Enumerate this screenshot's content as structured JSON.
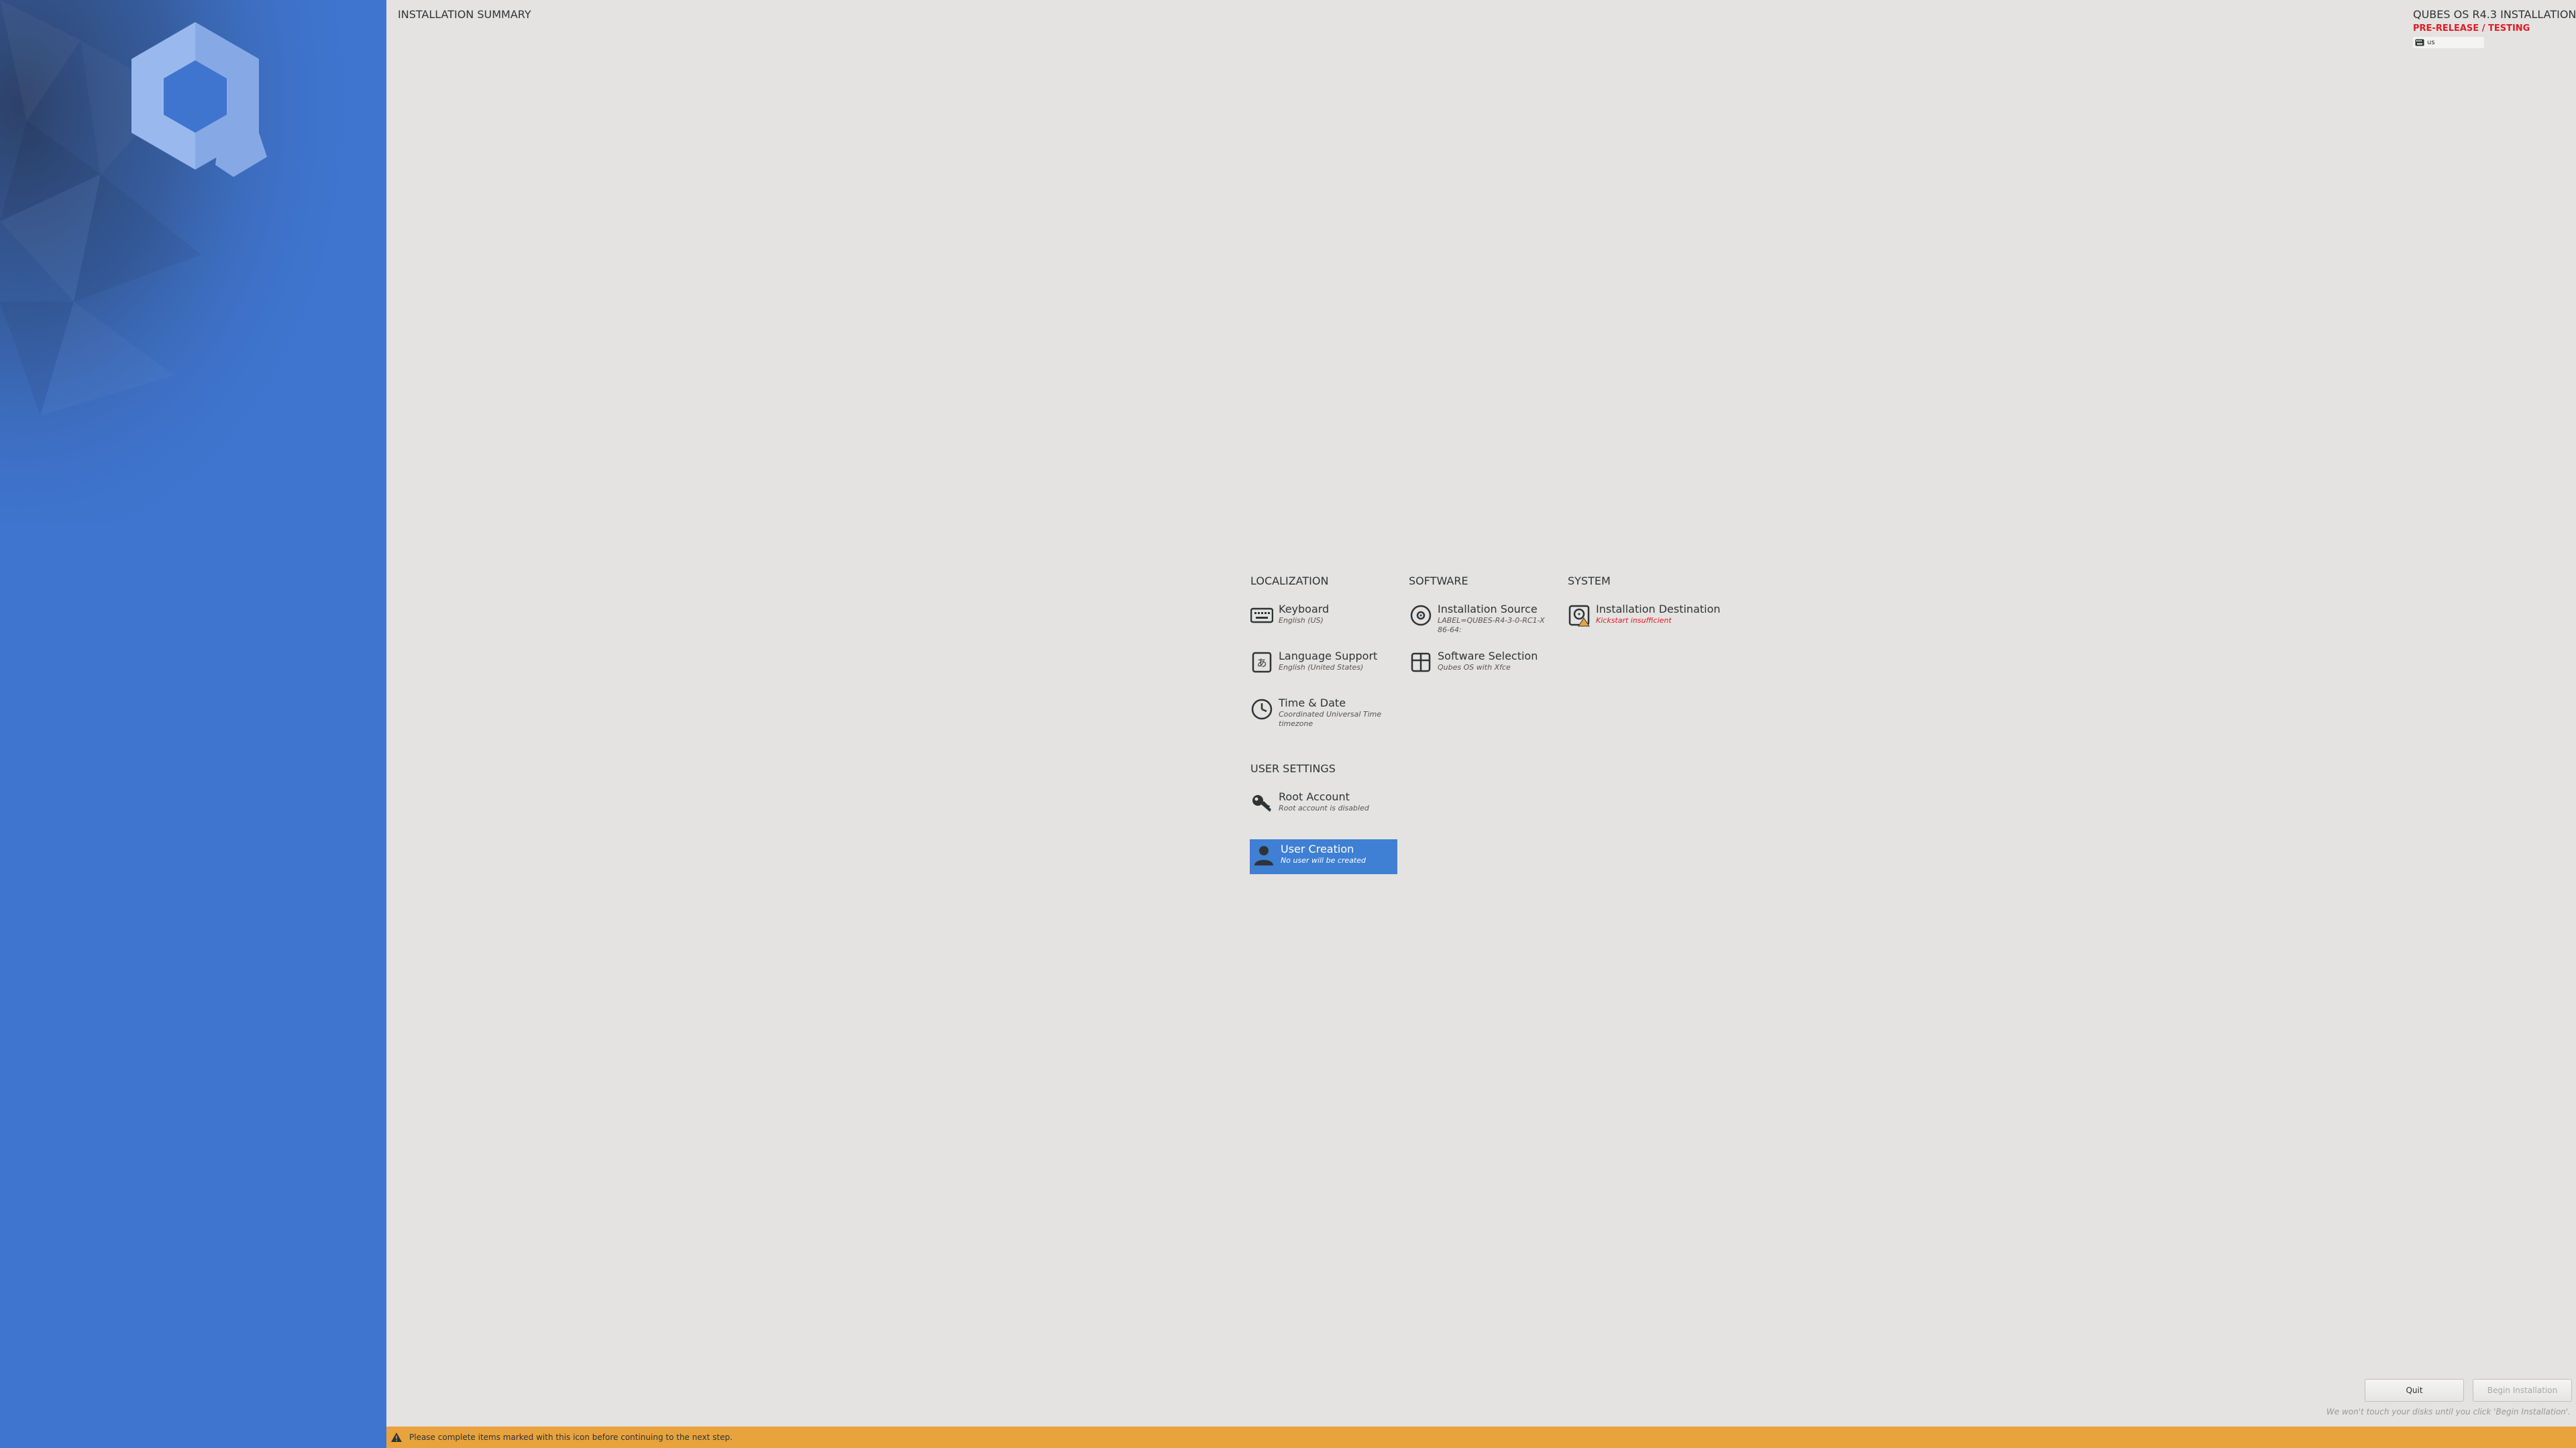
{
  "header": {
    "summary_title": "INSTALLATION SUMMARY",
    "product_title": "QUBES OS R4.3 INSTALLATION",
    "prerelease": "PRE-RELEASE / TESTING",
    "keyboard_layout": "us"
  },
  "categories": [
    {
      "title": "LOCALIZATION"
    },
    {
      "title": "SOFTWARE"
    },
    {
      "title": "SYSTEM"
    },
    {
      "title": "USER SETTINGS"
    }
  ],
  "spokes": {
    "keyboard": {
      "title": "Keyboard",
      "status": "English (US)",
      "icon": "keyboard-icon"
    },
    "language": {
      "title": "Language Support",
      "status": "English (United States)",
      "icon": "language-icon"
    },
    "time_date": {
      "title": "Time & Date",
      "status": "Coordinated Universal Time timezone",
      "icon": "clock-icon"
    },
    "installation_source": {
      "title": "Installation Source",
      "status": "LABEL=QUBES-R4-3-0-RC1-X86-64:",
      "icon": "disc-icon"
    },
    "software_selection": {
      "title": "Software Selection",
      "status": "Qubes OS with Xfce",
      "icon": "package-icon"
    },
    "installation_destination": {
      "title": "Installation Destination",
      "status": "Kickstart insufficient",
      "icon": "harddisk-warning-icon"
    },
    "root_account": {
      "title": "Root Account",
      "status": "Root account is disabled",
      "icon": "key-icon"
    },
    "user_creation": {
      "title": "User Creation",
      "status": "No user will be created",
      "icon": "user-icon"
    }
  },
  "buttons": {
    "quit": "Quit",
    "begin": "Begin Installation"
  },
  "disk_note": "We won't touch your disks until you click 'Begin Installation'.",
  "warning_bar": {
    "text": "Please complete items marked with this icon before continuing to the next step."
  },
  "colors": {
    "sidebar": "#3f75cf",
    "selected": "#3f7fd4",
    "warning_bar": "#e8a33d",
    "prerelease": "#e01b24",
    "background": "#e4e3e1"
  }
}
